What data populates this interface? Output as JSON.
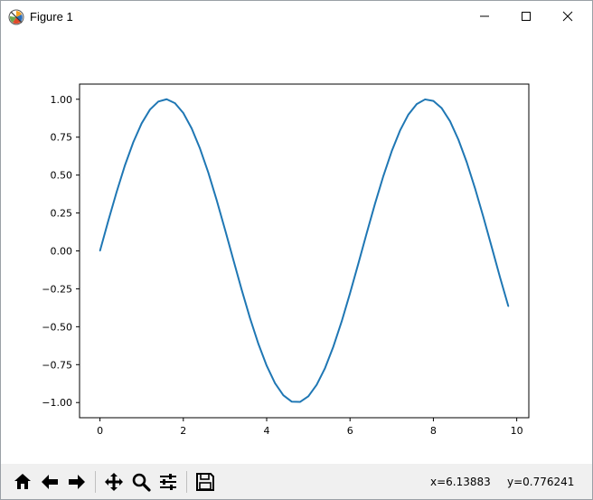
{
  "window": {
    "title": "Figure 1"
  },
  "chart_data": {
    "type": "line",
    "title": "",
    "xlabel": "",
    "ylabel": "",
    "xlim": [
      -0.49,
      10.29
    ],
    "ylim": [
      -1.1,
      1.1
    ],
    "xticks": [
      0,
      2,
      4,
      6,
      8,
      10
    ],
    "xtick_labels": [
      "0",
      "2",
      "4",
      "6",
      "8",
      "10"
    ],
    "yticks": [
      1.0,
      0.75,
      0.5,
      0.25,
      0.0,
      -0.25,
      -0.5,
      -0.75,
      -1.0
    ],
    "ytick_labels": [
      "1.00",
      "0.75",
      "0.50",
      "0.25",
      "0.00",
      "−0.25",
      "−0.50",
      "−0.75",
      "−1.00"
    ],
    "grid": false,
    "series": [
      {
        "color": "#1f77b4",
        "x": [
          0.0,
          0.2,
          0.4,
          0.6,
          0.8,
          1.0,
          1.2,
          1.4,
          1.6,
          1.8,
          2.0,
          2.2,
          2.4,
          2.6,
          2.8,
          3.0,
          3.2,
          3.4,
          3.6,
          3.8,
          4.0,
          4.2,
          4.4,
          4.6,
          4.8,
          5.0,
          5.2,
          5.4,
          5.6,
          5.8,
          6.0,
          6.2,
          6.4,
          6.6,
          6.8,
          7.0,
          7.2,
          7.4,
          7.6,
          7.8,
          8.0,
          8.2,
          8.4,
          8.6,
          8.8,
          9.0,
          9.2,
          9.4,
          9.6,
          9.8
        ],
        "y": [
          0.0,
          0.199,
          0.389,
          0.565,
          0.717,
          0.841,
          0.932,
          0.985,
          1.0,
          0.974,
          0.909,
          0.808,
          0.675,
          0.516,
          0.335,
          0.141,
          -0.058,
          -0.256,
          -0.443,
          -0.612,
          -0.757,
          -0.872,
          -0.952,
          -0.994,
          -0.996,
          -0.959,
          -0.883,
          -0.773,
          -0.631,
          -0.465,
          -0.279,
          -0.083,
          0.117,
          0.312,
          0.494,
          0.657,
          0.794,
          0.899,
          0.968,
          0.999,
          0.989,
          0.941,
          0.855,
          0.734,
          0.585,
          0.412,
          0.223,
          0.025,
          -0.175,
          -0.366
        ]
      }
    ]
  },
  "toolbar": {
    "buttons": [
      {
        "name": "home-icon"
      },
      {
        "name": "back-arrow-icon"
      },
      {
        "name": "forward-arrow-icon"
      },
      {
        "name": "pan-icon"
      },
      {
        "name": "zoom-icon"
      },
      {
        "name": "configure-subplots-icon"
      },
      {
        "name": "save-icon"
      }
    ],
    "coord_x": "x=6.13883",
    "coord_y": "y=0.776241"
  }
}
